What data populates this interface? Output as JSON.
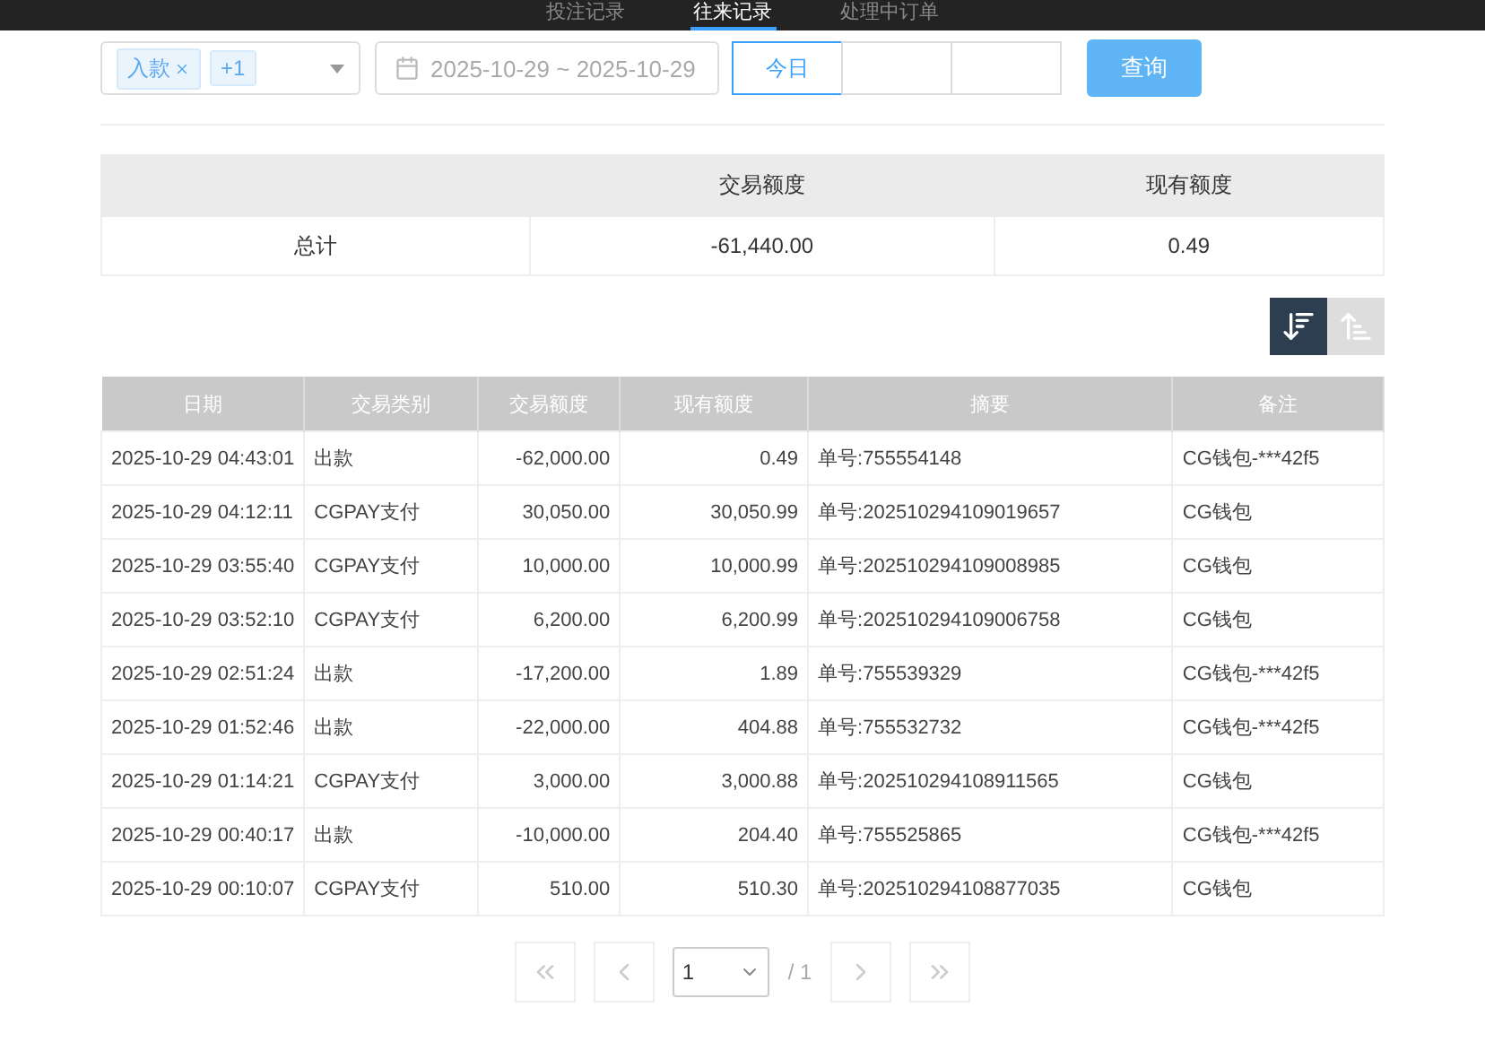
{
  "nav": {
    "tabs": [
      {
        "label": "投注记录",
        "selected": false
      },
      {
        "label": "往来记录",
        "selected": true
      },
      {
        "label": "处理中订单",
        "selected": false
      }
    ]
  },
  "filters": {
    "type_select": {
      "tags": [
        {
          "label": "入款",
          "removable": true
        },
        {
          "label": "+1",
          "removable": false
        }
      ]
    },
    "date_range": {
      "value": "2025-10-29 ~ 2025-10-29"
    },
    "quick_ranges": [
      {
        "label": "今日",
        "selected": true
      },
      {
        "selected": false
      },
      {
        "selected": false
      }
    ],
    "query_button": "查询"
  },
  "summary": {
    "columns": [
      "",
      "交易额度",
      "现有额度"
    ],
    "row": [
      "总计",
      "-61,440.00",
      "0.49"
    ]
  },
  "sort_buttons": [
    {
      "kind": "desc",
      "selected": true
    },
    {
      "kind": "asc",
      "selected": false
    }
  ],
  "table": {
    "columns": [
      "日期",
      "交易类别",
      "交易额度",
      "现有额度",
      "摘要",
      "备注"
    ],
    "rows": [
      [
        "2025-10-29 04:43:01",
        "出款",
        "-62,000.00",
        "0.49",
        "单号:755554148",
        "CG钱包-***42f5"
      ],
      [
        "2025-10-29 04:12:11",
        "CGPAY支付",
        "30,050.00",
        "30,050.99",
        "单号:202510294109019657",
        "CG钱包"
      ],
      [
        "2025-10-29 03:55:40",
        "CGPAY支付",
        "10,000.00",
        "10,000.99",
        "单号:202510294109008985",
        "CG钱包"
      ],
      [
        "2025-10-29 03:52:10",
        "CGPAY支付",
        "6,200.00",
        "6,200.99",
        "单号:202510294109006758",
        "CG钱包"
      ],
      [
        "2025-10-29 02:51:24",
        "出款",
        "-17,200.00",
        "1.89",
        "单号:755539329",
        "CG钱包-***42f5"
      ],
      [
        "2025-10-29 01:52:46",
        "出款",
        "-22,000.00",
        "404.88",
        "单号:755532732",
        "CG钱包-***42f5"
      ],
      [
        "2025-10-29 01:14:21",
        "CGPAY支付",
        "3,000.00",
        "3,000.88",
        "单号:202510294108911565",
        "CG钱包"
      ],
      [
        "2025-10-29 00:40:17",
        "出款",
        "-10,000.00",
        "204.40",
        "单号:755525865",
        "CG钱包-***42f5"
      ],
      [
        "2025-10-29 00:10:07",
        "CGPAY支付",
        "510.00",
        "510.30",
        "单号:202510294108877035",
        "CG钱包"
      ]
    ]
  },
  "pagination": {
    "page": "1",
    "total": "/ 1"
  }
}
